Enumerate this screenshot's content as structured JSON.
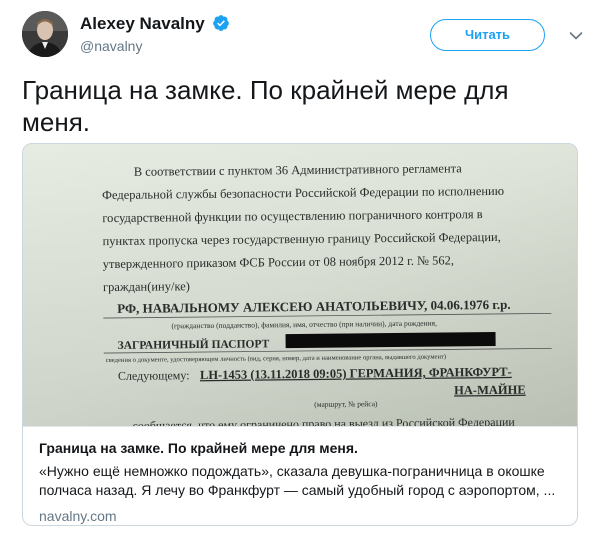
{
  "author": {
    "name": "Alexey Navalny",
    "handle": "@navalny"
  },
  "follow_button": {
    "label": "Читать"
  },
  "tweet": {
    "text": "Граница на замке. По крайней мере для меня."
  },
  "card": {
    "title": "Граница на замке. По крайней мере для меня.",
    "description_line1": "«Нужно ещё немножко подождать», сказала девушка-пограничница в окошке",
    "description_line2": "полчаса назад. Я лечу во Франкфурт — самый удобный город с аэропортом, ...",
    "domain": "navalny.com",
    "document": {
      "l1": "В   соответствии   с   пунктом   36   Административного   регламента",
      "l2": "Федеральной службы безопасности Российской Федерации по исполнению",
      "l3": "государственной функции по осуществлению пограничного контроля в",
      "l4": "пунктах пропуска через государственную границу Российской Федерации,",
      "l5": "утвержденного  приказом  ФСБ  России  от  08  ноября  2012  г.  №  562,",
      "l6": "граждан(ину/ке)",
      "name_line": "РФ, НАВАЛЬНОМУ АЛЕКСЕЮ АНАТОЛЬЕВИЧУ, 04.06.1976 г.р.",
      "name_caption": "(гражданство (подданство), фамилия, имя, отчество (при наличии), дата рождения,",
      "passport_line": "ЗАГРАНИЧНЫЙ ПАСПОРТ",
      "passport_caption": "сведения о документе, удостоверяющем личность (вид, серия, номер, дата и наименование органа, выдавшего документ)",
      "follows_label": "Следующему:",
      "flight_line1": "LH-1453 (13.11.2018 09:05) ГЕРМАНИЯ, ФРАНКФУРТ-",
      "flight_line2": "НА-МАЙНЕ",
      "flight_caption": "(маршрут, № рейса)",
      "bottom_line": "сообщается, что ему ограничено право на выезд из Российской Федерации"
    }
  },
  "colors": {
    "accent": "#1da1f2",
    "text": "#14171a",
    "secondary": "#657786",
    "border": "#ccd6dd"
  },
  "icons": {
    "verified": "verified-badge-icon",
    "caret": "chevron-down-icon"
  }
}
